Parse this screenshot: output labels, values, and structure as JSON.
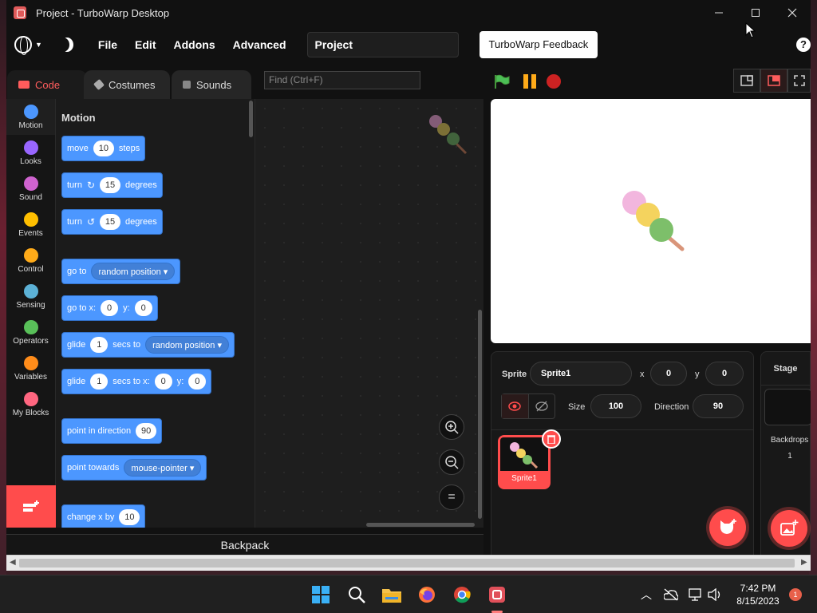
{
  "window": {
    "title": "Project - TurboWarp Desktop"
  },
  "menu": {
    "file": "File",
    "edit": "Edit",
    "addons": "Addons",
    "advanced": "Advanced",
    "project_title": "Project",
    "feedback": "TurboWarp Feedback",
    "help": "?"
  },
  "tabs": {
    "code": "Code",
    "costumes": "Costumes",
    "sounds": "Sounds"
  },
  "find": {
    "placeholder": "Find (Ctrl+F)"
  },
  "categories": [
    {
      "label": "Motion",
      "color": "#4c97ff"
    },
    {
      "label": "Looks",
      "color": "#9966ff"
    },
    {
      "label": "Sound",
      "color": "#cf63cf"
    },
    {
      "label": "Events",
      "color": "#ffbf00"
    },
    {
      "label": "Control",
      "color": "#ffab19"
    },
    {
      "label": "Sensing",
      "color": "#5cb1d6"
    },
    {
      "label": "Operators",
      "color": "#59c059"
    },
    {
      "label": "Variables",
      "color": "#ff8c1a"
    },
    {
      "label": "My Blocks",
      "color": "#ff6680"
    }
  ],
  "flyout": {
    "title": "Motion",
    "move": {
      "a": "move",
      "n": "10",
      "b": "steps"
    },
    "turn_right": {
      "a": "turn",
      "n": "15",
      "b": "degrees"
    },
    "turn_left": {
      "a": "turn",
      "n": "15",
      "b": "degrees"
    },
    "go_to": {
      "a": "go to",
      "d": "random position"
    },
    "go_to_xy": {
      "a": "go to x:",
      "x": "0",
      "y_label": "y:",
      "y": "0"
    },
    "glide_to": {
      "a": "glide",
      "n": "1",
      "b": "secs to",
      "d": "random position"
    },
    "glide_xy": {
      "a": "glide",
      "n": "1",
      "b": "secs to x:",
      "x": "0",
      "y_label": "y:",
      "y": "0"
    },
    "point_dir": {
      "a": "point in direction",
      "n": "90"
    },
    "point_towards": {
      "a": "point towards",
      "d": "mouse-pointer"
    },
    "change_x": {
      "a": "change x by",
      "n": "10"
    }
  },
  "zoom": {
    "in": "+",
    "out": "−",
    "reset": "="
  },
  "backpack": "Backpack",
  "sprite_info": {
    "sprite_label": "Sprite",
    "sprite_name": "Sprite1",
    "x_label": "x",
    "x": "0",
    "y_label": "y",
    "y": "0",
    "size_label": "Size",
    "size": "100",
    "direction_label": "Direction",
    "direction": "90"
  },
  "sprite_list": [
    {
      "name": "Sprite1"
    }
  ],
  "stage_pane": {
    "title": "Stage",
    "backdrops_label": "Backdrops",
    "backdrops_count": "1"
  },
  "taskbar": {
    "time": "7:42 PM",
    "date": "8/15/2023",
    "notifications": "1",
    "apps": [
      "start-icon",
      "search-icon",
      "file-explorer-icon",
      "firefox-icon",
      "chrome-icon",
      "turbowarp-icon"
    ]
  },
  "colors": {
    "accent": "#ff4c4c",
    "motion": "#4c97ff",
    "window_bg": "#111111"
  }
}
